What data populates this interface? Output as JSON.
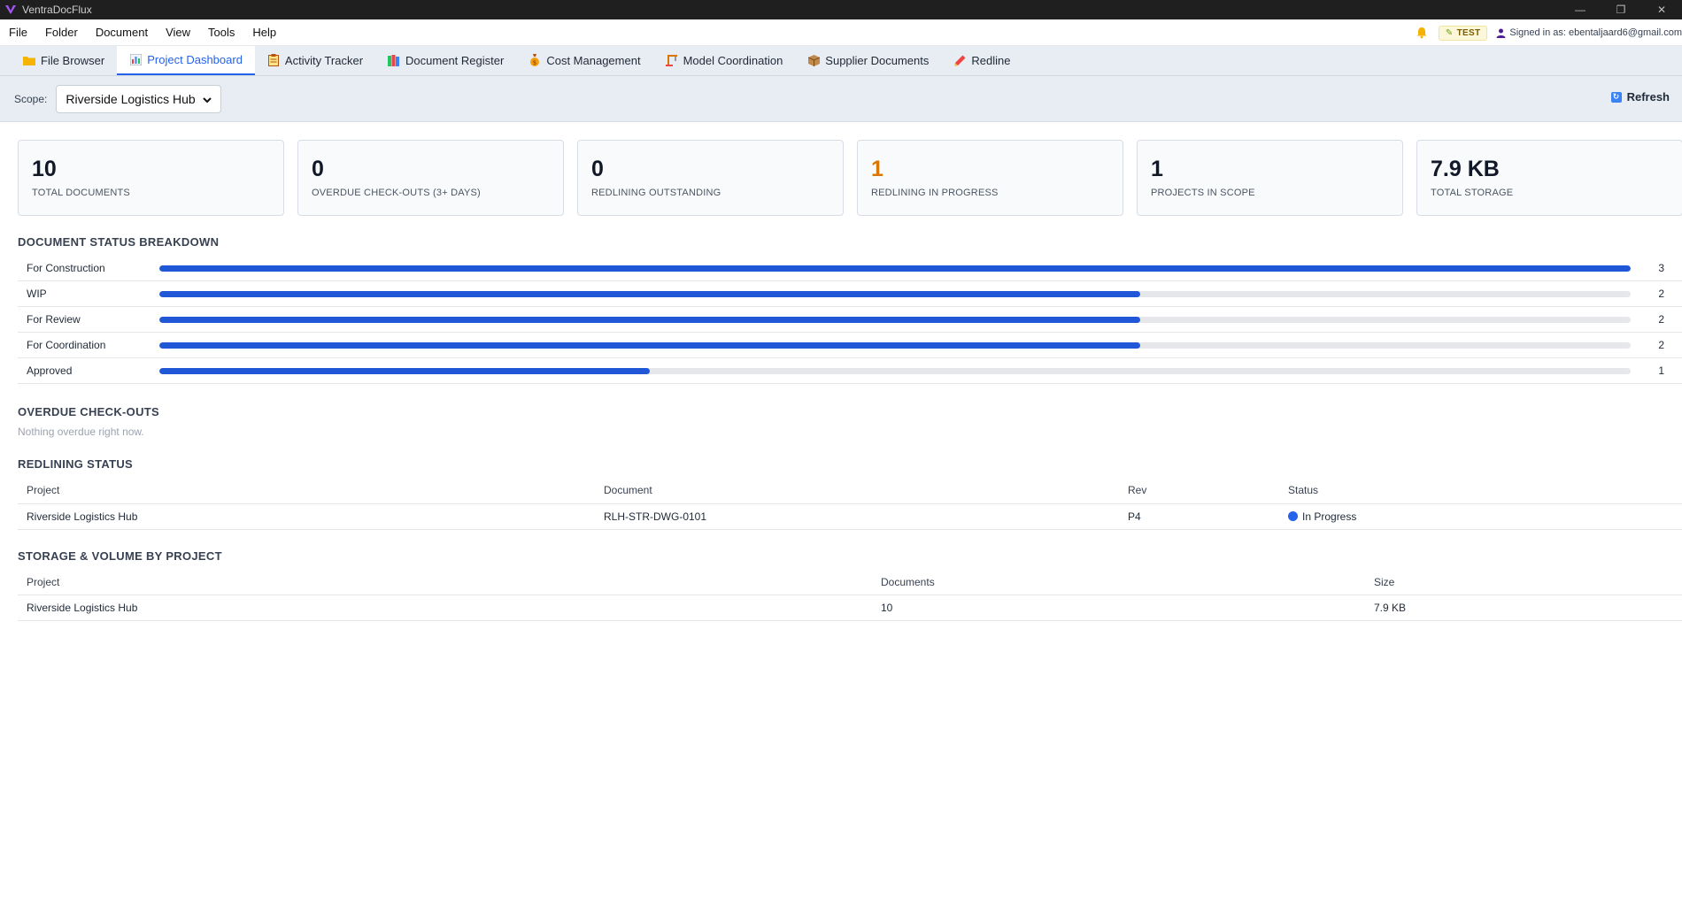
{
  "window": {
    "title": "VentraDocFlux"
  },
  "menu": [
    "File",
    "Folder",
    "Document",
    "View",
    "Tools",
    "Help"
  ],
  "header": {
    "env_badge": "TEST",
    "signed_in": "Signed in as: ebentaljaard6@gmail.com"
  },
  "tabs": [
    {
      "label": "File Browser",
      "icon": "folder-icon",
      "active": false
    },
    {
      "label": "Project Dashboard",
      "icon": "chart-icon",
      "active": true
    },
    {
      "label": "Activity Tracker",
      "icon": "clipboard-icon",
      "active": false
    },
    {
      "label": "Document Register",
      "icon": "books-icon",
      "active": false
    },
    {
      "label": "Cost Management",
      "icon": "money-bag-icon",
      "active": false
    },
    {
      "label": "Model Coordination",
      "icon": "crane-icon",
      "active": false
    },
    {
      "label": "Supplier Documents",
      "icon": "package-icon",
      "active": false
    },
    {
      "label": "Redline",
      "icon": "pencil-icon",
      "active": false
    }
  ],
  "scope": {
    "label": "Scope:",
    "value": "Riverside Logistics Hub",
    "refresh_label": "Refresh"
  },
  "kpis": [
    {
      "value": "10",
      "label": "TOTAL DOCUMENTS"
    },
    {
      "value": "0",
      "label": "OVERDUE CHECK-OUTS (3+ DAYS)"
    },
    {
      "value": "0",
      "label": "REDLINING OUTSTANDING"
    },
    {
      "value": "1",
      "label": "REDLINING IN PROGRESS"
    },
    {
      "value": "1",
      "label": "PROJECTS IN SCOPE"
    },
    {
      "value": "7.9 KB",
      "label": "TOTAL STORAGE"
    }
  ],
  "status_breakdown": {
    "title": "DOCUMENT STATUS BREAKDOWN",
    "max": 3,
    "rows": [
      {
        "name": "For Construction",
        "count": 3
      },
      {
        "name": "WIP",
        "count": 2
      },
      {
        "name": "For Review",
        "count": 2
      },
      {
        "name": "For Coordination",
        "count": 2
      },
      {
        "name": "Approved",
        "count": 1
      }
    ]
  },
  "overdue": {
    "title": "OVERDUE CHECK-OUTS",
    "empty_text": "Nothing overdue right now."
  },
  "redlining": {
    "title": "REDLINING STATUS",
    "headers": {
      "project": "Project",
      "document": "Document",
      "rev": "Rev",
      "status": "Status"
    },
    "rows": [
      {
        "project": "Riverside Logistics Hub",
        "document": "RLH-STR-DWG-0101",
        "rev": "P4",
        "status": "In Progress"
      }
    ]
  },
  "storage": {
    "title": "STORAGE & VOLUME BY PROJECT",
    "headers": {
      "project": "Project",
      "documents": "Documents",
      "size": "Size"
    },
    "rows": [
      {
        "project": "Riverside Logistics Hub",
        "documents": "10",
        "size": "7.9 KB"
      }
    ]
  },
  "colors": {
    "accent": "#2563eb",
    "bar": "#2057d6",
    "warning": "#d97706"
  }
}
